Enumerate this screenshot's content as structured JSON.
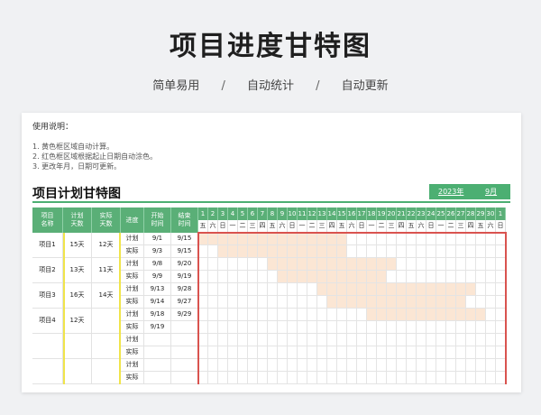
{
  "header": {
    "title": "项目进度甘特图",
    "features": [
      "简单易用",
      "自动统计",
      "自动更新"
    ],
    "separator": "/"
  },
  "usage": {
    "title": "使用说明：",
    "items": [
      "1. 黄色框区域自动计算。",
      "2. 红色框区域根据起止日期自动涂色。",
      "3. 更改年月，日期可更新。"
    ]
  },
  "gantt": {
    "title": "项目计划甘特图",
    "year": "2023年",
    "month": "9月",
    "columns": {
      "name": "项目\n名称",
      "planned_days": "计划\n天数",
      "actual_days": "实际\n天数",
      "progress": "进度",
      "start": "开始\n时间",
      "end": "结束\n时间"
    },
    "days": [
      "1",
      "2",
      "3",
      "4",
      "5",
      "6",
      "7",
      "8",
      "9",
      "10",
      "11",
      "12",
      "13",
      "14",
      "15",
      "16",
      "17",
      "18",
      "19",
      "20",
      "21",
      "22",
      "23",
      "24",
      "25",
      "26",
      "27",
      "28",
      "29",
      "30",
      "1"
    ],
    "weekdays": [
      "五",
      "六",
      "日",
      "一",
      "二",
      "三",
      "四",
      "五",
      "六",
      "日",
      "一",
      "二",
      "三",
      "四",
      "五",
      "六",
      "日",
      "一",
      "二",
      "三",
      "四",
      "五",
      "六",
      "日",
      "一",
      "二",
      "三",
      "四",
      "五",
      "六",
      "日"
    ],
    "projects": [
      {
        "name": "项目1",
        "planned_days": "15天",
        "actual_days": "12天",
        "rows": [
          {
            "type": "计划",
            "start": "9/1",
            "end": "9/15"
          },
          {
            "type": "实际",
            "start": "9/3",
            "end": "9/15"
          }
        ]
      },
      {
        "name": "项目2",
        "planned_days": "13天",
        "actual_days": "11天",
        "rows": [
          {
            "type": "计划",
            "start": "9/8",
            "end": "9/20"
          },
          {
            "type": "实际",
            "start": "9/9",
            "end": "9/19"
          }
        ]
      },
      {
        "name": "项目3",
        "planned_days": "16天",
        "actual_days": "14天",
        "rows": [
          {
            "type": "计划",
            "start": "9/13",
            "end": "9/28"
          },
          {
            "type": "实际",
            "start": "9/14",
            "end": "9/27"
          }
        ]
      },
      {
        "name": "项目4",
        "planned_days": "12天",
        "actual_days": "",
        "rows": [
          {
            "type": "计划",
            "start": "9/18",
            "end": "9/29"
          },
          {
            "type": "实际",
            "start": "9/19",
            "end": ""
          }
        ]
      },
      {
        "name": "",
        "planned_days": "",
        "actual_days": "",
        "rows": [
          {
            "type": "计划",
            "start": "",
            "end": ""
          },
          {
            "type": "实际",
            "start": "",
            "end": ""
          }
        ]
      },
      {
        "name": "",
        "planned_days": "",
        "actual_days": "",
        "rows": [
          {
            "type": "计划",
            "start": "",
            "end": ""
          },
          {
            "type": "实际",
            "start": "",
            "end": ""
          }
        ]
      }
    ],
    "colors": {
      "header": "#5aaf77",
      "bar": "#fbe6d4",
      "highlight_yellow": "#f0e44a",
      "highlight_red": "#d9534f"
    }
  }
}
